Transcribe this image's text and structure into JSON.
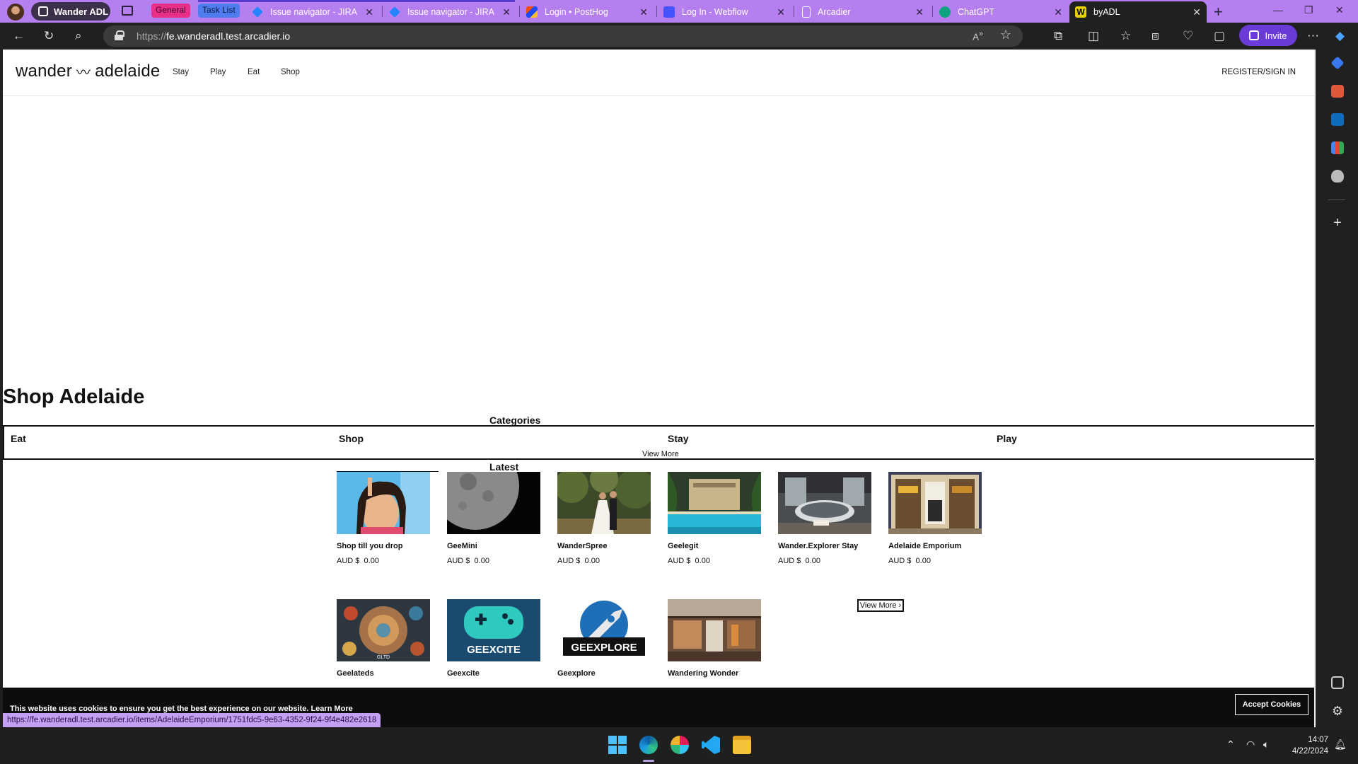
{
  "browser": {
    "workspace_label": "Wander ADL",
    "tab_groups": [
      "General",
      "Task List"
    ],
    "tabs": [
      {
        "title": "Issue navigator - JIRA",
        "icon": "jira-icon",
        "color": "#2684ff"
      },
      {
        "title": "Issue navigator - JIRA",
        "icon": "jira-icon",
        "color": "#2684ff"
      },
      {
        "title": "Login • PostHog",
        "icon": "posthog-icon",
        "color": "#f54e00"
      },
      {
        "title": "Log In - Webflow",
        "icon": "webflow-icon",
        "color": "#4353ff"
      },
      {
        "title": "Arcadier",
        "icon": "page-icon",
        "color": "#ffffff"
      },
      {
        "title": "ChatGPT",
        "icon": "chatgpt-icon",
        "color": "#10a37f"
      },
      {
        "title": "byADL",
        "icon": "w-logo-icon",
        "color": "#e5d200",
        "active": true
      }
    ],
    "url_scheme": "https://",
    "url_host": "fe.wanderadl.test.arcadier.io",
    "invite_label": "Invite",
    "status_url": "https://fe.wanderadl.test.arcadier.io/items/AdelaideEmporium/1751fdc5-9e63-4352-9f24-9f4e482e2618"
  },
  "site": {
    "logo_left": "wander",
    "logo_wave": "〰",
    "logo_right": "adelaide",
    "nav": [
      "Stay",
      "Play",
      "Eat",
      "Shop"
    ],
    "register_label": "REGISTER/SIGN IN",
    "section_title": "Shop Adelaide",
    "categories_heading": "Categories",
    "categories": [
      "Eat",
      "Shop",
      "Stay",
      "Play"
    ],
    "categories_view_more": "View More",
    "latest_heading": "Latest",
    "currency": "AUD $",
    "items_row1": [
      {
        "name": "Shop till you drop",
        "price": "0.00"
      },
      {
        "name": "GeeMini",
        "price": "0.00"
      },
      {
        "name": "WanderSpree",
        "price": "0.00"
      },
      {
        "name": "Geelegit",
        "price": "0.00"
      },
      {
        "name": "Wander.Explorer Stay",
        "price": "0.00"
      },
      {
        "name": "Adelaide Emporium",
        "price": "0.00"
      }
    ],
    "items_row2": [
      {
        "name": "Geelateds",
        "thumb_text": "GLTD"
      },
      {
        "name": "Geexcite",
        "thumb_text": "GEEXCITE"
      },
      {
        "name": "Geexplore",
        "thumb_text": "GEEXPLORE"
      },
      {
        "name": "Wandering Wonder",
        "thumb_text": ""
      }
    ],
    "latest_view_more": "View More",
    "cookie_text": "This website uses cookies to ensure you get the best experience on our website. Learn More",
    "accept_cookies": "Accept Cookies"
  },
  "taskbar": {
    "time": "14:07",
    "date": "4/22/2024"
  }
}
